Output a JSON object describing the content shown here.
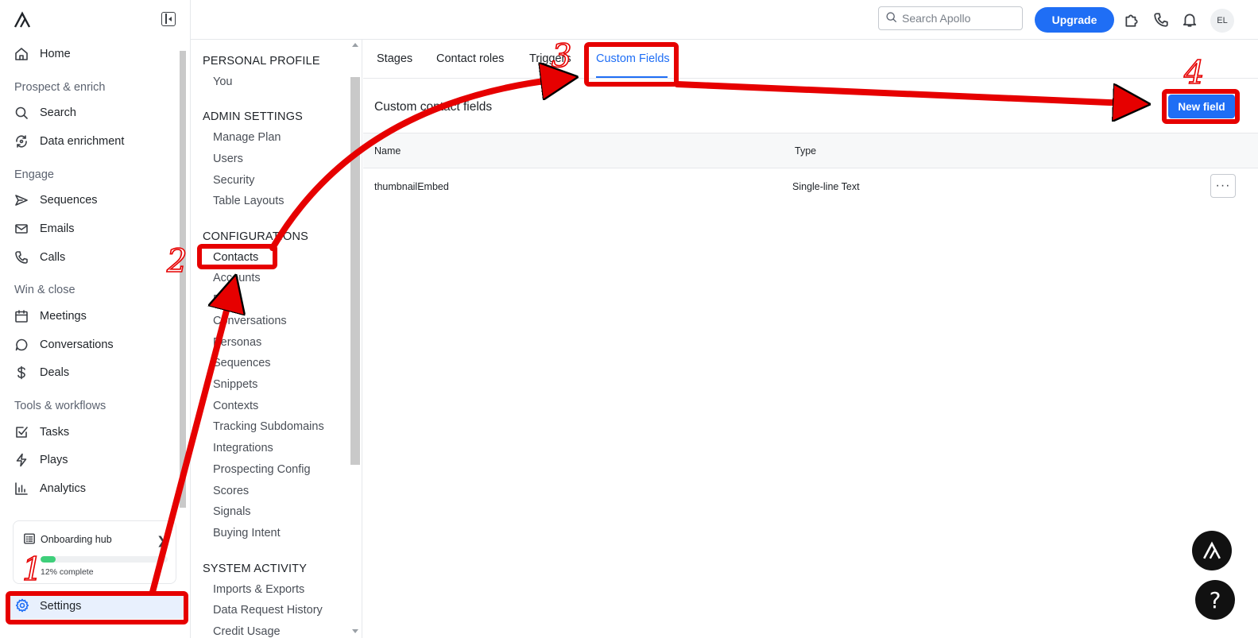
{
  "nav": {
    "home": "Home",
    "section_prospect": "Prospect & enrich",
    "search": "Search",
    "data_enrichment": "Data enrichment",
    "section_engage": "Engage",
    "sequences": "Sequences",
    "emails": "Emails",
    "calls": "Calls",
    "section_win": "Win & close",
    "meetings": "Meetings",
    "conversations": "Conversations",
    "deals": "Deals",
    "section_tools": "Tools & workflows",
    "tasks": "Tasks",
    "plays": "Plays",
    "analytics": "Analytics",
    "settings": "Settings"
  },
  "onboarding": {
    "title": "Onboarding hub",
    "progress": 0.12,
    "progress_label": "12% complete"
  },
  "topbar": {
    "search_placeholder": "Search Apollo",
    "upgrade": "Upgrade",
    "avatar_initials": "EL"
  },
  "submenu": {
    "personal_profile": "PERSONAL PROFILE",
    "you": "You",
    "admin_settings": "ADMIN SETTINGS",
    "manage_plan": "Manage Plan",
    "users": "Users",
    "security": "Security",
    "table_layouts": "Table Layouts",
    "configurations": "CONFIGURATIONS",
    "contacts": "Contacts",
    "accounts": "Accounts",
    "deals": "Deals",
    "conversations": "Conversations",
    "personas": "Personas",
    "sequences": "Sequences",
    "snippets": "Snippets",
    "contexts": "Contexts",
    "tracking_subdomains": "Tracking Subdomains",
    "integrations": "Integrations",
    "prospecting_config": "Prospecting Config",
    "scores": "Scores",
    "signals": "Signals",
    "buying_intent": "Buying Intent",
    "system_activity": "SYSTEM ACTIVITY",
    "imports_exports": "Imports & Exports",
    "data_request_history": "Data Request History",
    "credit_usage": "Credit Usage"
  },
  "tabs": {
    "stages": "Stages",
    "contact_roles": "Contact roles",
    "triggers": "Triggers",
    "custom_fields": "Custom Fields"
  },
  "main": {
    "section_title": "Custom contact fields",
    "new_field": "New field",
    "col_name": "Name",
    "col_type": "Type",
    "rows": [
      {
        "name": "thumbnailEmbed",
        "type": "Single-line Text"
      }
    ],
    "more": "···",
    "help": "?"
  },
  "annotations": {
    "step1": "1",
    "step2": "2",
    "step3": "3",
    "step4": "4",
    "color": "#e60000"
  }
}
